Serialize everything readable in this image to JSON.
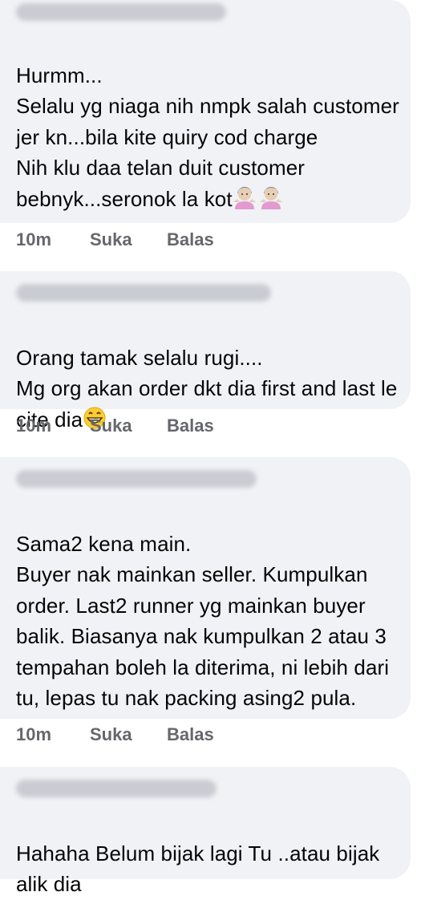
{
  "comments": [
    {
      "text_lines": "Hurmm...\nSelalu yg niaga nih nmpk salah customer jer kn...bila kite quiry cod charge\nNih klu daa telan duit customer bebnyk...seronok la kot",
      "emoji": "shrug",
      "time": "10m",
      "like_label": "Suka",
      "reply_label": "Balas"
    },
    {
      "text_lines": "Orang tamak selalu rugi....\nMg org akan order dkt dia first and last le cite dia",
      "emoji": "grin",
      "time": "10m",
      "like_label": "Suka",
      "reply_label": "Balas"
    },
    {
      "text_lines": "Sama2 kena main.\nBuyer nak mainkan seller. Kumpulkan order. Last2 runner yg mainkan buyer balik. Biasanya nak kumpulkan 2 atau 3 tempahan boleh la diterima, ni lebih dari tu, lepas tu nak packing asing2 pula.",
      "time": "10m",
      "like_label": "Suka",
      "reply_label": "Balas"
    },
    {
      "text_lines": "Hahaha Belum bijak lagi Tu ..atau bijak alik dia"
    }
  ]
}
